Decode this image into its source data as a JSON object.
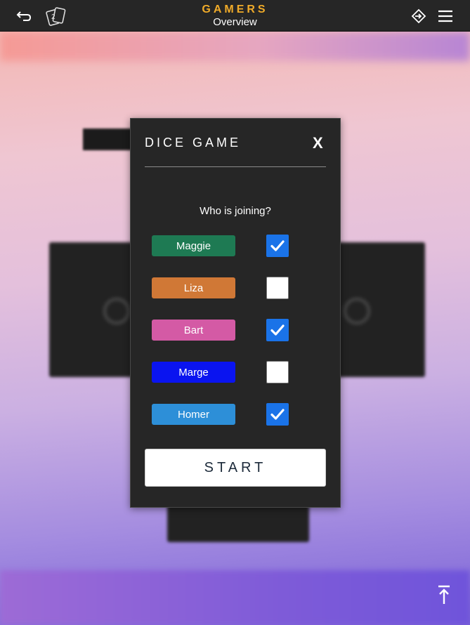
{
  "header": {
    "brand": "GAMERS",
    "subtitle": "Overview"
  },
  "modal": {
    "title": "DICE GAME",
    "close_label": "X",
    "question": "Who is joining?",
    "start_label": "START",
    "players": [
      {
        "name": "Maggie",
        "color": "#1e7a53",
        "checked": true
      },
      {
        "name": "Liza",
        "color": "#d07836",
        "checked": false
      },
      {
        "name": "Bart",
        "color": "#d45aa5",
        "checked": true
      },
      {
        "name": "Marge",
        "color": "#0a14f0",
        "checked": false
      },
      {
        "name": "Homer",
        "color": "#2d8fd8",
        "checked": true
      }
    ]
  },
  "icons": {
    "back": "back-arrow-icon",
    "logo": "cards-logo-icon",
    "login": "login-icon",
    "menu": "hamburger-menu-icon",
    "scroll_top": "scroll-to-top-icon",
    "check": "checkmark-icon"
  }
}
